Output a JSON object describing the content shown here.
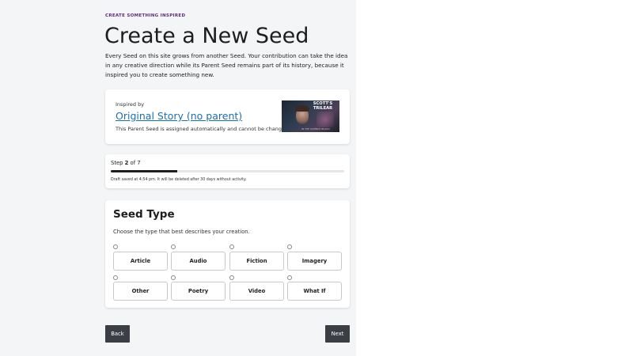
{
  "header": {
    "kicker": "CREATE SOMETHING INSPIRED",
    "title": "Create a New Seed",
    "intro": "Every Seed on this site grows from another Seed. Your contribution can take the idea in any creative direction while its Parent Seed remains part of its history, because it inspired you to create something new."
  },
  "parent": {
    "label": "Inspired by",
    "link_text": "Original Story (no parent)",
    "note": "This Parent Seed is assigned automatically and cannot be changed.",
    "thumbnail": {
      "title": "SCOTT'S TRILEAR",
      "subtitle": "IN THE SCIENCE BOARD"
    }
  },
  "progress": {
    "step_prefix": "Step ",
    "step_current": "2",
    "step_suffix": " of 7",
    "fraction": 0.2857,
    "draft_note": "Draft saved at 4:54 pm. It will be deleted after 30 days without activity."
  },
  "seed_type": {
    "title": "Seed Type",
    "subtitle": "Choose the type that best describes your creation.",
    "options": [
      "Article",
      "Audio",
      "Fiction",
      "Imagery",
      "Other",
      "Poetry",
      "Video",
      "What If"
    ]
  },
  "nav": {
    "back_label": "Back",
    "next_label": "Next"
  },
  "colors": {
    "accent": "#5b2a86",
    "link": "#1a6fb5",
    "button": "#3b3e44"
  }
}
